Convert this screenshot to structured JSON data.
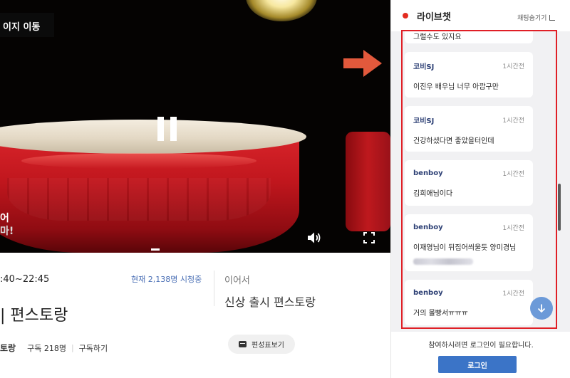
{
  "video": {
    "page_move_label": "이지 이동",
    "overlay_text_line1": "어",
    "overlay_text_line2": "마!",
    "controls": {
      "pause_icon": "pause-icon",
      "volume_icon": "volume-icon",
      "fullscreen_icon": "fullscreen-icon"
    }
  },
  "program": {
    "time_range": ":40~22:45",
    "viewers": "현재 2,138명 시청중",
    "title": "| 편스토랑",
    "channel_name": "토랑",
    "subscribers": "구독 218명",
    "subscribe_label": "구독하기",
    "next_label": "이어서",
    "next_title": "신상 출시 편스토랑",
    "schedule_label": "편성표보기"
  },
  "chat": {
    "title": "라이브챗",
    "hide_label": "채팅숨기기",
    "messages": [
      {
        "user": "",
        "time": "",
        "text": "그럴수도 있지요"
      },
      {
        "user": "코비SJ",
        "time": "1시간전",
        "text": "이진우 배우님 너무 아깝구만"
      },
      {
        "user": "코비SJ",
        "time": "1시간전",
        "text": "건강하셨다면 좋았을터인데"
      },
      {
        "user": "benboy",
        "time": "1시간전",
        "text": "김희애님이다"
      },
      {
        "user": "benboy",
        "time": "1시간전",
        "text": "이재영님이 뒤집어씌울듯 양미경님"
      },
      {
        "user": "benboy",
        "time": "1시간전",
        "text": "거의 몰빵서ㅠㅠㅠ"
      }
    ],
    "login_notice": "참여하시려면 로그인이 필요합니다.",
    "login_label": "로그인"
  },
  "colors": {
    "accent_red": "#e01f26",
    "live_dot": "#e32b1f",
    "login_blue": "#3b74c7",
    "viewers_blue": "#4a6fb5",
    "arrow_orange": "#e2593c"
  }
}
